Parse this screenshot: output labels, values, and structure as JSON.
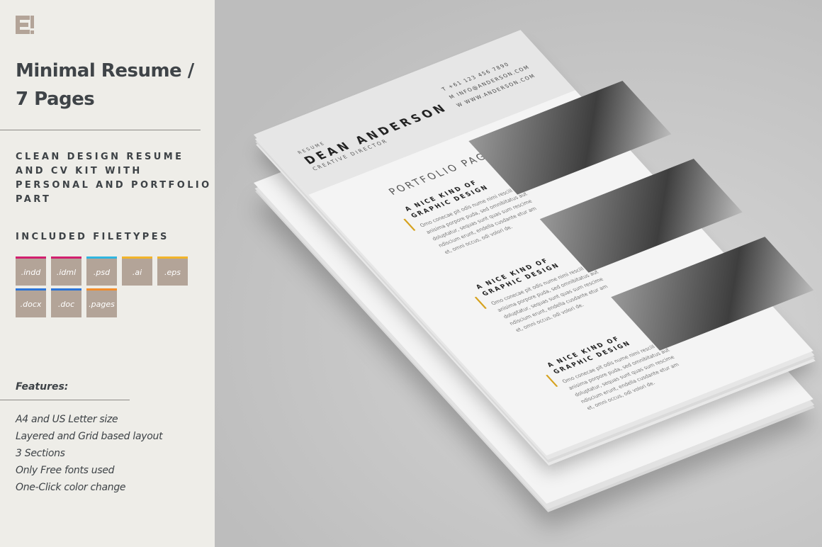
{
  "sidebar": {
    "logo": "E",
    "title_line1": "Minimal Resume /",
    "title_line2": "7 Pages",
    "tagline": "CLEAN DESIGN RESUME AND CV KIT WITH PERSONAL AND PORTFOLIO PART",
    "filetypes_heading": "INCLUDED FILETYPES",
    "filetypes": [
      {
        "label": ".indd",
        "color": "#d21f6e"
      },
      {
        "label": ".idml",
        "color": "#d21f6e"
      },
      {
        "label": ".psd",
        "color": "#2fb6e0"
      },
      {
        "label": ".ai",
        "color": "#f2b429"
      },
      {
        "label": ".eps",
        "color": "#f2b429"
      },
      {
        "label": ".docx",
        "color": "#2b74d8"
      },
      {
        "label": ".doc",
        "color": "#2b74d8"
      },
      {
        "label": ".pages",
        "color": "#f28c2b"
      }
    ],
    "features_heading": "Features:",
    "features": [
      "A4 and US Letter size",
      "Layered and Grid based layout",
      "3 Sections",
      "Only Free fonts used",
      "One-Click color change"
    ]
  },
  "mockup": {
    "kicker": "RESUME",
    "name": "DEAN ANDERSON",
    "role": "CREATIVE DIRECTOR",
    "contact": [
      "T  +61 123 456 7890",
      "M  INFO@ANDERSON.COM",
      "W  WWW.ANDERSON.COM"
    ],
    "section_title": "PORTFOLIO PAGE 2",
    "items": [
      {
        "heading": "A NICE KIND OF GRAPHIC DESIGN",
        "body": "Omo conecae pit odis nume nimi resciil anisima porpore puda, sed omnibitatus aut doluptatur, sequas sunt quas sum rescime ndiscium erunt, endella cusdante etur am et, omni occus, odi volori de."
      },
      {
        "heading": "A NICE KIND OF GRAPHIC DESIGN",
        "body": "Omo conecae pit odis nume nimi resciil anisima porpore puda, sed omnibitatus aut doluptatur, sequas sunt quas sum rescime ndiscium erunt, endella cusdante etur am et, omni occus, odi volori de."
      },
      {
        "heading": "A NICE KIND OF GRAPHIC DESIGN",
        "body": "Omo conecae pit odis nume nimi resciil anisima porpore puda, sed omnibitatus aut doluptatur, sequas sunt quas sum rescime ndiscium erunt, endella cusdante etur am et, omni occus, odi volori de."
      }
    ],
    "accent": "#d6a21e"
  }
}
